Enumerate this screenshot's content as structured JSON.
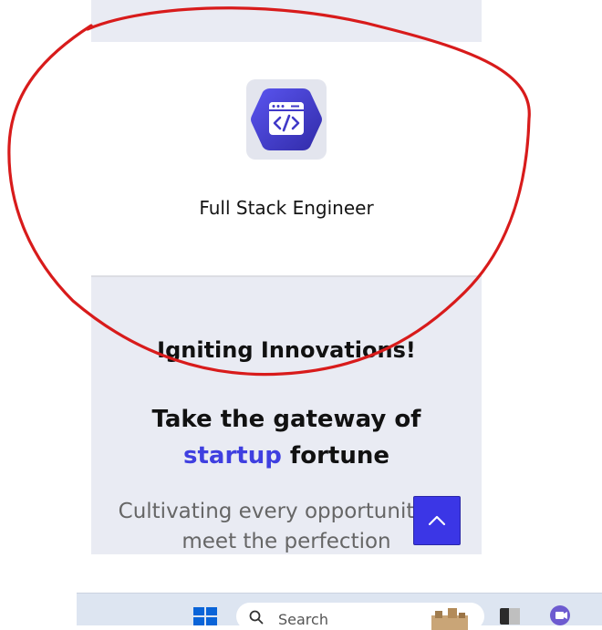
{
  "card": {
    "icon": "code-window-icon",
    "title": "Full Stack Engineer"
  },
  "hero": {
    "tagline": "Igniting Innovations!",
    "headline_pre": "Take the gateway of ",
    "headline_accent": "startup",
    "headline_post": " fortune",
    "description": "Cultivating every opportunity to meet the perfection"
  },
  "scroll_top": {
    "icon": "chevron-up-icon"
  },
  "taskbar": {
    "search_placeholder": "Search",
    "icons": [
      "windows-start-icon",
      "search-icon",
      "app-icon",
      "meet-icon"
    ]
  },
  "colors": {
    "accent": "#3f3fe0",
    "scroll_button": "#3b36e6",
    "annotation": "#d81b1b",
    "panel_bg": "#e9ebf3"
  }
}
